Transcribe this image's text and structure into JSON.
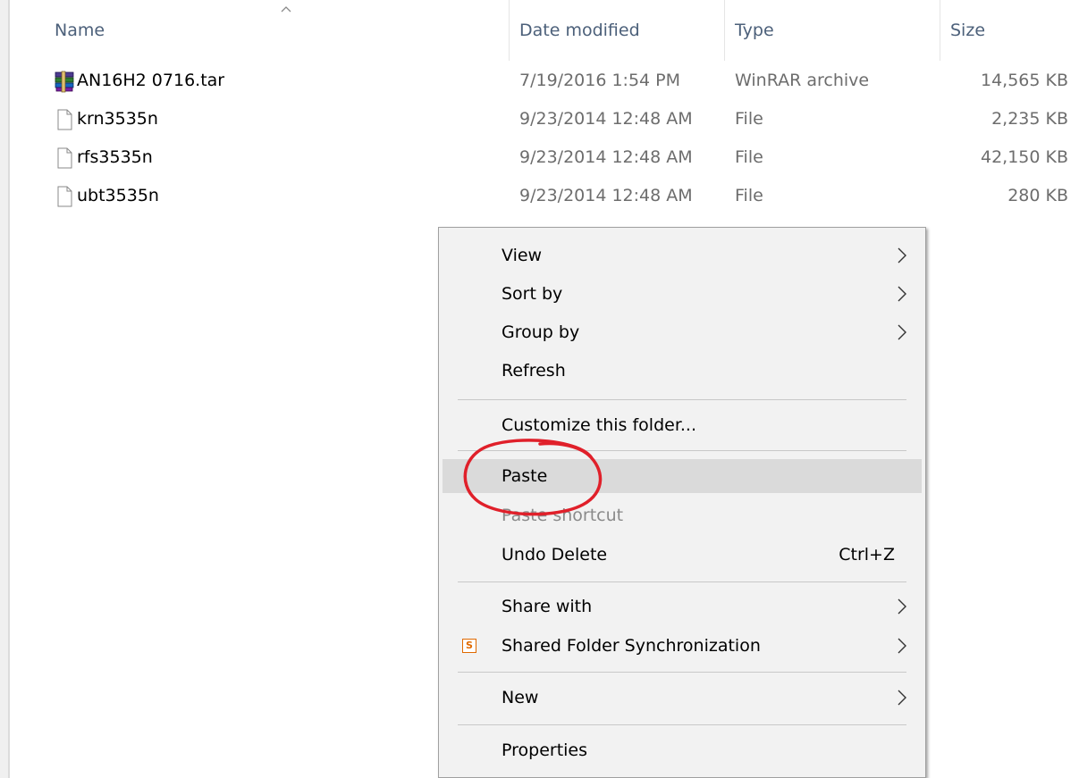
{
  "columns": {
    "name": "Name",
    "date_modified": "Date modified",
    "type": "Type",
    "size": "Size"
  },
  "files": [
    {
      "name": "AN16H2 0716.tar",
      "date": "7/19/2016 1:54 PM",
      "type": "WinRAR archive",
      "size": "14,565 KB",
      "icon": "winrar-archive-icon"
    },
    {
      "name": "krn3535n",
      "date": "9/23/2014 12:48 AM",
      "type": "File",
      "size": "2,235 KB",
      "icon": "file-icon"
    },
    {
      "name": "rfs3535n",
      "date": "9/23/2014 12:48 AM",
      "type": "File",
      "size": "42,150 KB",
      "icon": "file-icon"
    },
    {
      "name": "ubt3535n",
      "date": "9/23/2014 12:48 AM",
      "type": "File",
      "size": "280 KB",
      "icon": "file-icon"
    }
  ],
  "context_menu": {
    "view": "View",
    "sort_by": "Sort by",
    "group_by": "Group by",
    "refresh": "Refresh",
    "customize": "Customize this folder...",
    "paste": "Paste",
    "paste_shortcut": "Paste shortcut",
    "undo_delete": "Undo Delete",
    "undo_delete_shortcut": "Ctrl+Z",
    "share_with": "Share with",
    "shared_folder_sync": "Shared Folder Synchronization",
    "shared_folder_sync_icon_letter": "S",
    "new": "New",
    "properties": "Properties"
  },
  "colors": {
    "annotation": "#e0202a",
    "highlight": "#dadada",
    "menu_bg": "#f2f2f2",
    "header_text": "#4c607a"
  }
}
